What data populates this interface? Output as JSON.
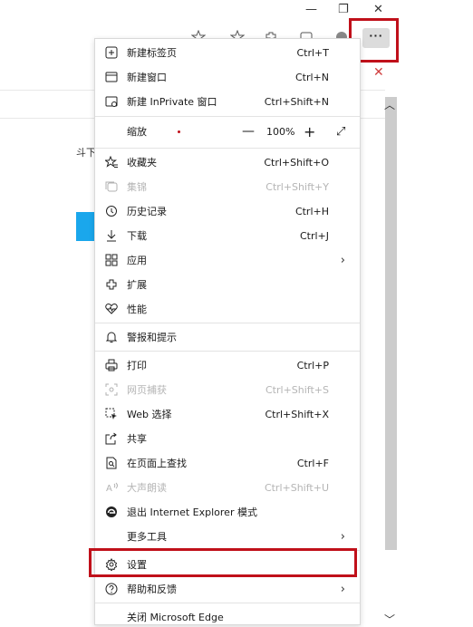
{
  "window": {
    "minimize": "—",
    "restore": "❐",
    "close": "✕"
  },
  "toolbar": {
    "more_label": "···"
  },
  "background": {
    "partial_text": "斗下"
  },
  "menu": {
    "items": [
      {
        "label": "新建标签页",
        "shortcut": "Ctrl+T",
        "icon": "new-tab-icon"
      },
      {
        "label": "新建窗口",
        "shortcut": "Ctrl+N",
        "icon": "new-window-icon"
      },
      {
        "label": "新建 InPrivate 窗口",
        "shortcut": "Ctrl+Shift+N",
        "icon": "inprivate-icon"
      },
      {
        "label": "缩放",
        "zoom_minus": "—",
        "zoom_value": "100%",
        "zoom_plus": "+",
        "icon": ""
      },
      {
        "label": "收藏夹",
        "shortcut": "Ctrl+Shift+O",
        "icon": "favorites-icon"
      },
      {
        "label": "集锦",
        "shortcut": "Ctrl+Shift+Y",
        "icon": "collections-icon",
        "disabled": true
      },
      {
        "label": "历史记录",
        "shortcut": "Ctrl+H",
        "icon": "history-icon"
      },
      {
        "label": "下载",
        "shortcut": "Ctrl+J",
        "icon": "download-icon"
      },
      {
        "label": "应用",
        "shortcut": "",
        "icon": "apps-icon",
        "submenu": true
      },
      {
        "label": "扩展",
        "shortcut": "",
        "icon": "extensions-icon"
      },
      {
        "label": "性能",
        "shortcut": "",
        "icon": "performance-icon"
      },
      {
        "label": "警报和提示",
        "shortcut": "",
        "icon": "bell-icon"
      },
      {
        "label": "打印",
        "shortcut": "Ctrl+P",
        "icon": "print-icon"
      },
      {
        "label": "网页捕获",
        "shortcut": "Ctrl+Shift+S",
        "icon": "capture-icon",
        "disabled": true
      },
      {
        "label": "Web 选择",
        "shortcut": "Ctrl+Shift+X",
        "icon": "web-select-icon"
      },
      {
        "label": "共享",
        "shortcut": "",
        "icon": "share-icon"
      },
      {
        "label": "在页面上查找",
        "shortcut": "Ctrl+F",
        "icon": "find-icon"
      },
      {
        "label": "大声朗读",
        "shortcut": "Ctrl+Shift+U",
        "icon": "read-aloud-icon",
        "disabled": true
      },
      {
        "label": "退出 Internet Explorer 模式",
        "shortcut": "",
        "icon": "ie-mode-icon"
      },
      {
        "label": "更多工具",
        "shortcut": "",
        "icon": "",
        "submenu": true
      },
      {
        "label": "设置",
        "shortcut": "",
        "icon": "settings-icon"
      },
      {
        "label": "帮助和反馈",
        "shortcut": "",
        "icon": "help-icon",
        "submenu": true
      },
      {
        "label": "关闭 Microsoft Edge",
        "shortcut": "",
        "icon": ""
      }
    ]
  },
  "colors": {
    "highlight": "#c0101a",
    "disabled": "#b5b5b5"
  }
}
